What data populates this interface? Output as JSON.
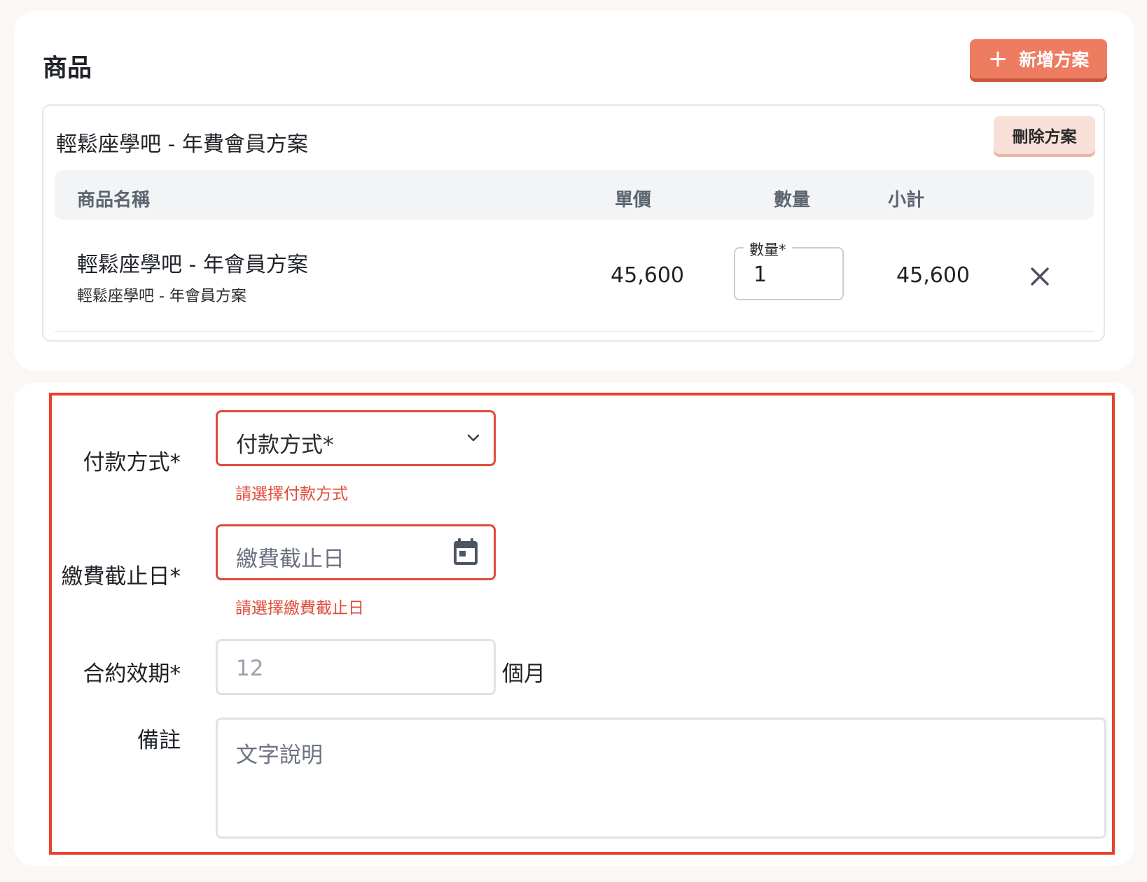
{
  "products": {
    "title": "商品",
    "add_button": "新增方案",
    "add_icon": "plus-icon",
    "plan": {
      "title": "輕鬆座學吧 - 年費會員方案",
      "delete_button": "刪除方案",
      "columns": {
        "name": "商品名稱",
        "price": "單價",
        "quantity": "數量",
        "subtotal": "小計"
      },
      "rows": [
        {
          "name": "輕鬆座學吧 - 年會員方案",
          "subname": "輕鬆座學吧 - 年會員方案",
          "price": "45,600",
          "quantity_label": "數量*",
          "quantity": "1",
          "subtotal": "45,600",
          "remove_icon": "close-icon"
        }
      ]
    }
  },
  "form": {
    "payment_method": {
      "label": "付款方式*",
      "placeholder": "付款方式*",
      "error": "請選擇付款方式",
      "icon": "chevron-down-icon"
    },
    "due_date": {
      "label": "繳費截止日*",
      "placeholder": "繳費截止日",
      "error": "請選擇繳費截止日",
      "icon": "calendar-icon"
    },
    "contract_period": {
      "label": "合約效期*",
      "placeholder": "12",
      "unit": "個月"
    },
    "notes": {
      "label": "備註",
      "placeholder": "文字說明"
    }
  },
  "colors": {
    "accent": "#ee7c61",
    "error": "#e04b3a",
    "highlight_frame": "#e8432b"
  }
}
